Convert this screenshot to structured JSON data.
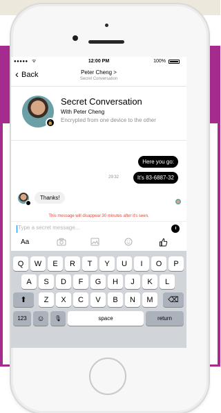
{
  "status_bar": {
    "signal": "●●●●●",
    "wifi": "ᯤ",
    "time": "12:00 PM",
    "battery": "100%"
  },
  "nav": {
    "back_label": "Back",
    "title": "Peter Cheng >",
    "subtitle": "Secret Conversation"
  },
  "header": {
    "title": "Secret Conversation",
    "with": "With Peter Cheng",
    "description": "Encrypted from one device to the other"
  },
  "messages": {
    "out_1": "Here you go:",
    "out_2": "It's 83-6887-32",
    "timestamp": "29:32",
    "in_1": "Thanks!",
    "disappear_notice": "This message will disappear 30 minutes after it's seen."
  },
  "composer": {
    "placeholder": "Type a secret message..."
  },
  "toolbar": {
    "aa_label": "Aa"
  },
  "keyboard": {
    "row1": [
      "Q",
      "W",
      "E",
      "R",
      "T",
      "Y",
      "U",
      "I",
      "O",
      "P"
    ],
    "row2": [
      "A",
      "S",
      "D",
      "F",
      "G",
      "H",
      "J",
      "K",
      "L"
    ],
    "row3": [
      "Z",
      "X",
      "C",
      "V",
      "B",
      "N",
      "M"
    ],
    "shift": "⬆",
    "backspace": "⌫",
    "numbers": "123",
    "emoji": "☺",
    "mic": "🎙",
    "space": "space",
    "return": "return"
  },
  "icons": {
    "camera": "camera-icon",
    "gallery": "gallery-icon",
    "emoji": "emoji-icon",
    "like": "thumbs-up-icon",
    "timer": "timer-icon"
  }
}
